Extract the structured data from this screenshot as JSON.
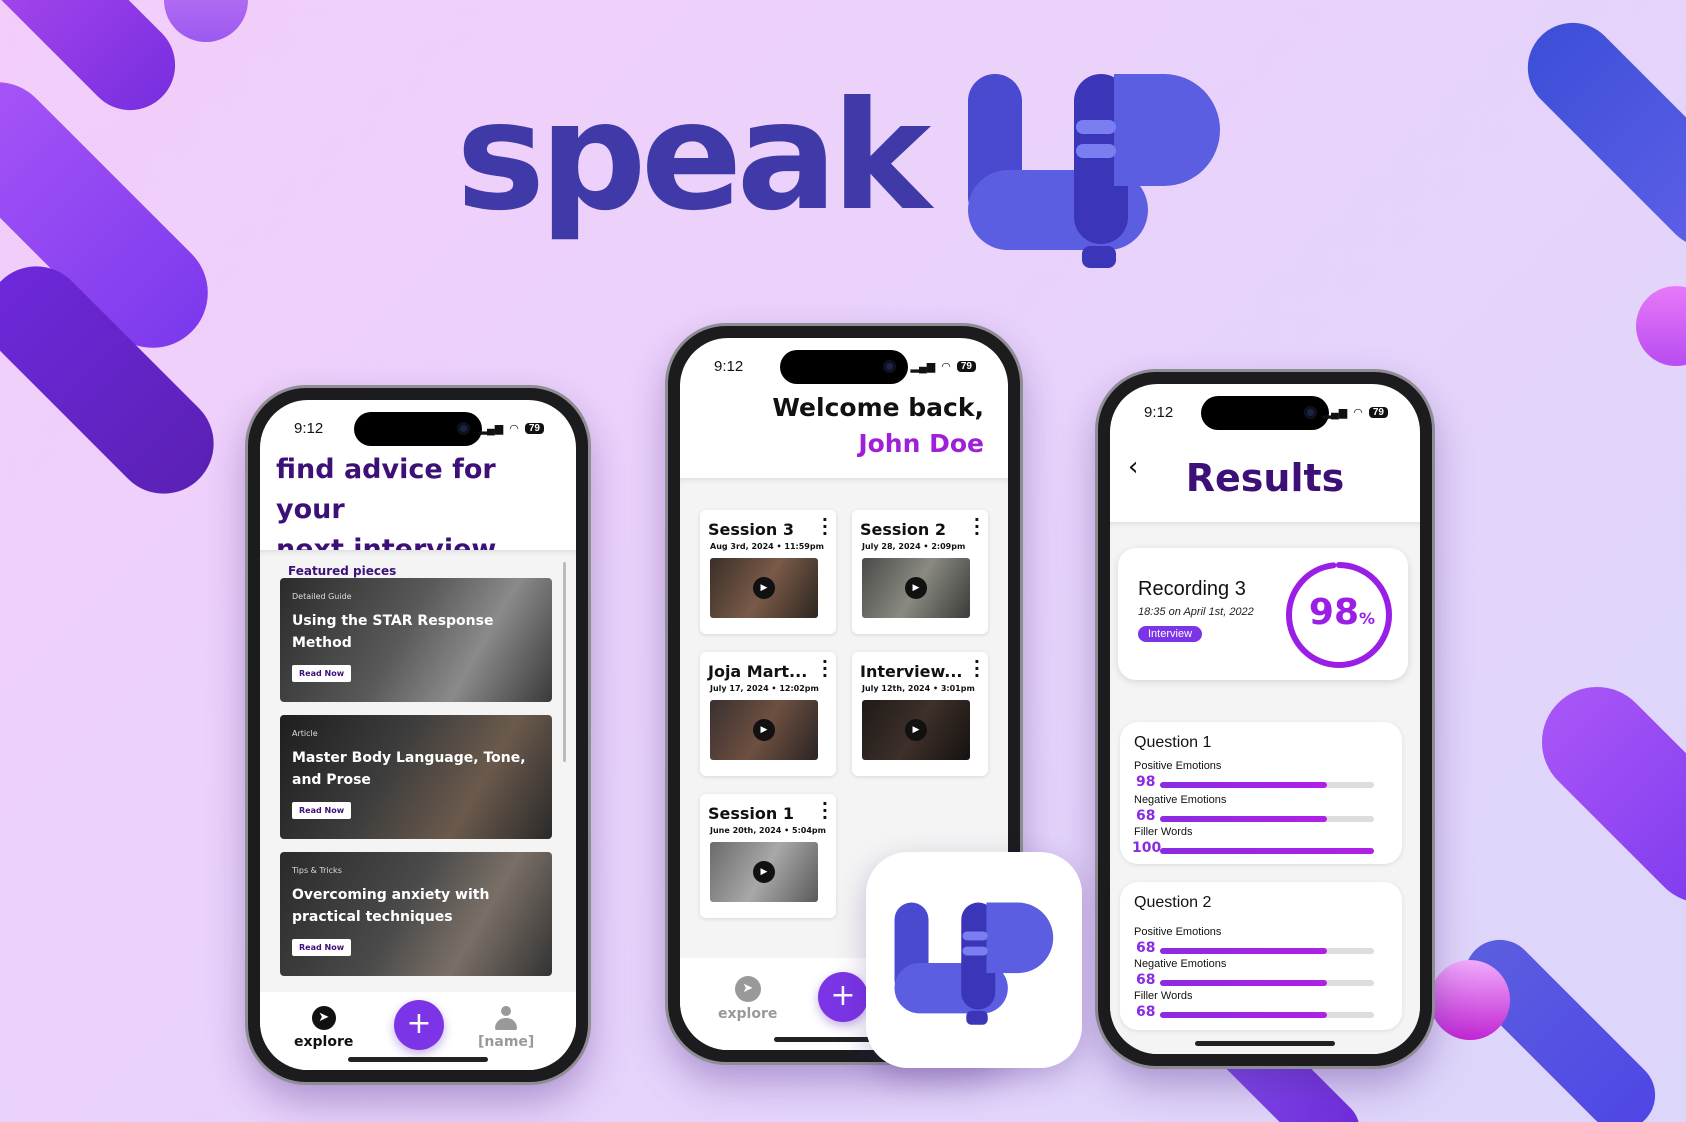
{
  "brand": {
    "wordmark": "speak",
    "logo_letters": "UP",
    "colors": {
      "primary": "#3f3aa8",
      "accent": "#7b35e6",
      "logo_light": "#5b5ee0"
    }
  },
  "status_bar": {
    "time": "9:12",
    "battery": "79"
  },
  "phone1": {
    "title_line1": "find advice for your",
    "title_line2": "next interview...",
    "featured_label": "Featured pieces",
    "cards": [
      {
        "kind": "Detailed Guide",
        "title": "Using the STAR Response Method",
        "cta": "Read Now"
      },
      {
        "kind": "Article",
        "title": "Master Body Language, Tone, and Prose",
        "cta": "Read Now"
      },
      {
        "kind": "Tips & Tricks",
        "title": "Overcoming anxiety with practical techniques",
        "cta": "Read Now"
      }
    ],
    "nav": {
      "explore": "explore",
      "add": "+",
      "profile": "[name]"
    }
  },
  "phone2": {
    "greeting": "Welcome back,",
    "user_name": "John Doe",
    "sessions": [
      {
        "name": "Session 3",
        "date": "Aug 3rd, 2024 • 11:59pm"
      },
      {
        "name": "Session 2",
        "date": "July 28, 2024 • 2:09pm"
      },
      {
        "name": "Joja Mart...",
        "date": "July 17, 2024 • 12:02pm"
      },
      {
        "name": "Interview...",
        "date": "July 12th, 2024 • 3:01pm"
      },
      {
        "name": "Session 1",
        "date": "June 20th, 2024 • 5:04pm"
      }
    ],
    "nav": {
      "explore": "explore",
      "add": "+"
    }
  },
  "phone3": {
    "back": "‹",
    "title": "Results",
    "recording": {
      "name": "Recording 3",
      "timestamp": "18:35 on April 1st, 2022",
      "tag": "Interview",
      "score": "98",
      "score_unit": "%",
      "score_fraction": 0.98
    },
    "questions": [
      {
        "title": "Question 1",
        "metrics": [
          {
            "label": "Positive Emotions",
            "value": "98",
            "fraction": 0.78
          },
          {
            "label": "Negative Emotions",
            "value": "68",
            "fraction": 0.78
          },
          {
            "label": "Filler Words",
            "value": "100",
            "fraction": 1.0
          }
        ]
      },
      {
        "title": "Question 2",
        "metrics": [
          {
            "label": "Positive Emotions",
            "value": "68",
            "fraction": 0.78
          },
          {
            "label": "Negative Emotions",
            "value": "68",
            "fraction": 0.78
          },
          {
            "label": "Filler Words",
            "value": "68",
            "fraction": 0.78
          }
        ]
      }
    ]
  }
}
